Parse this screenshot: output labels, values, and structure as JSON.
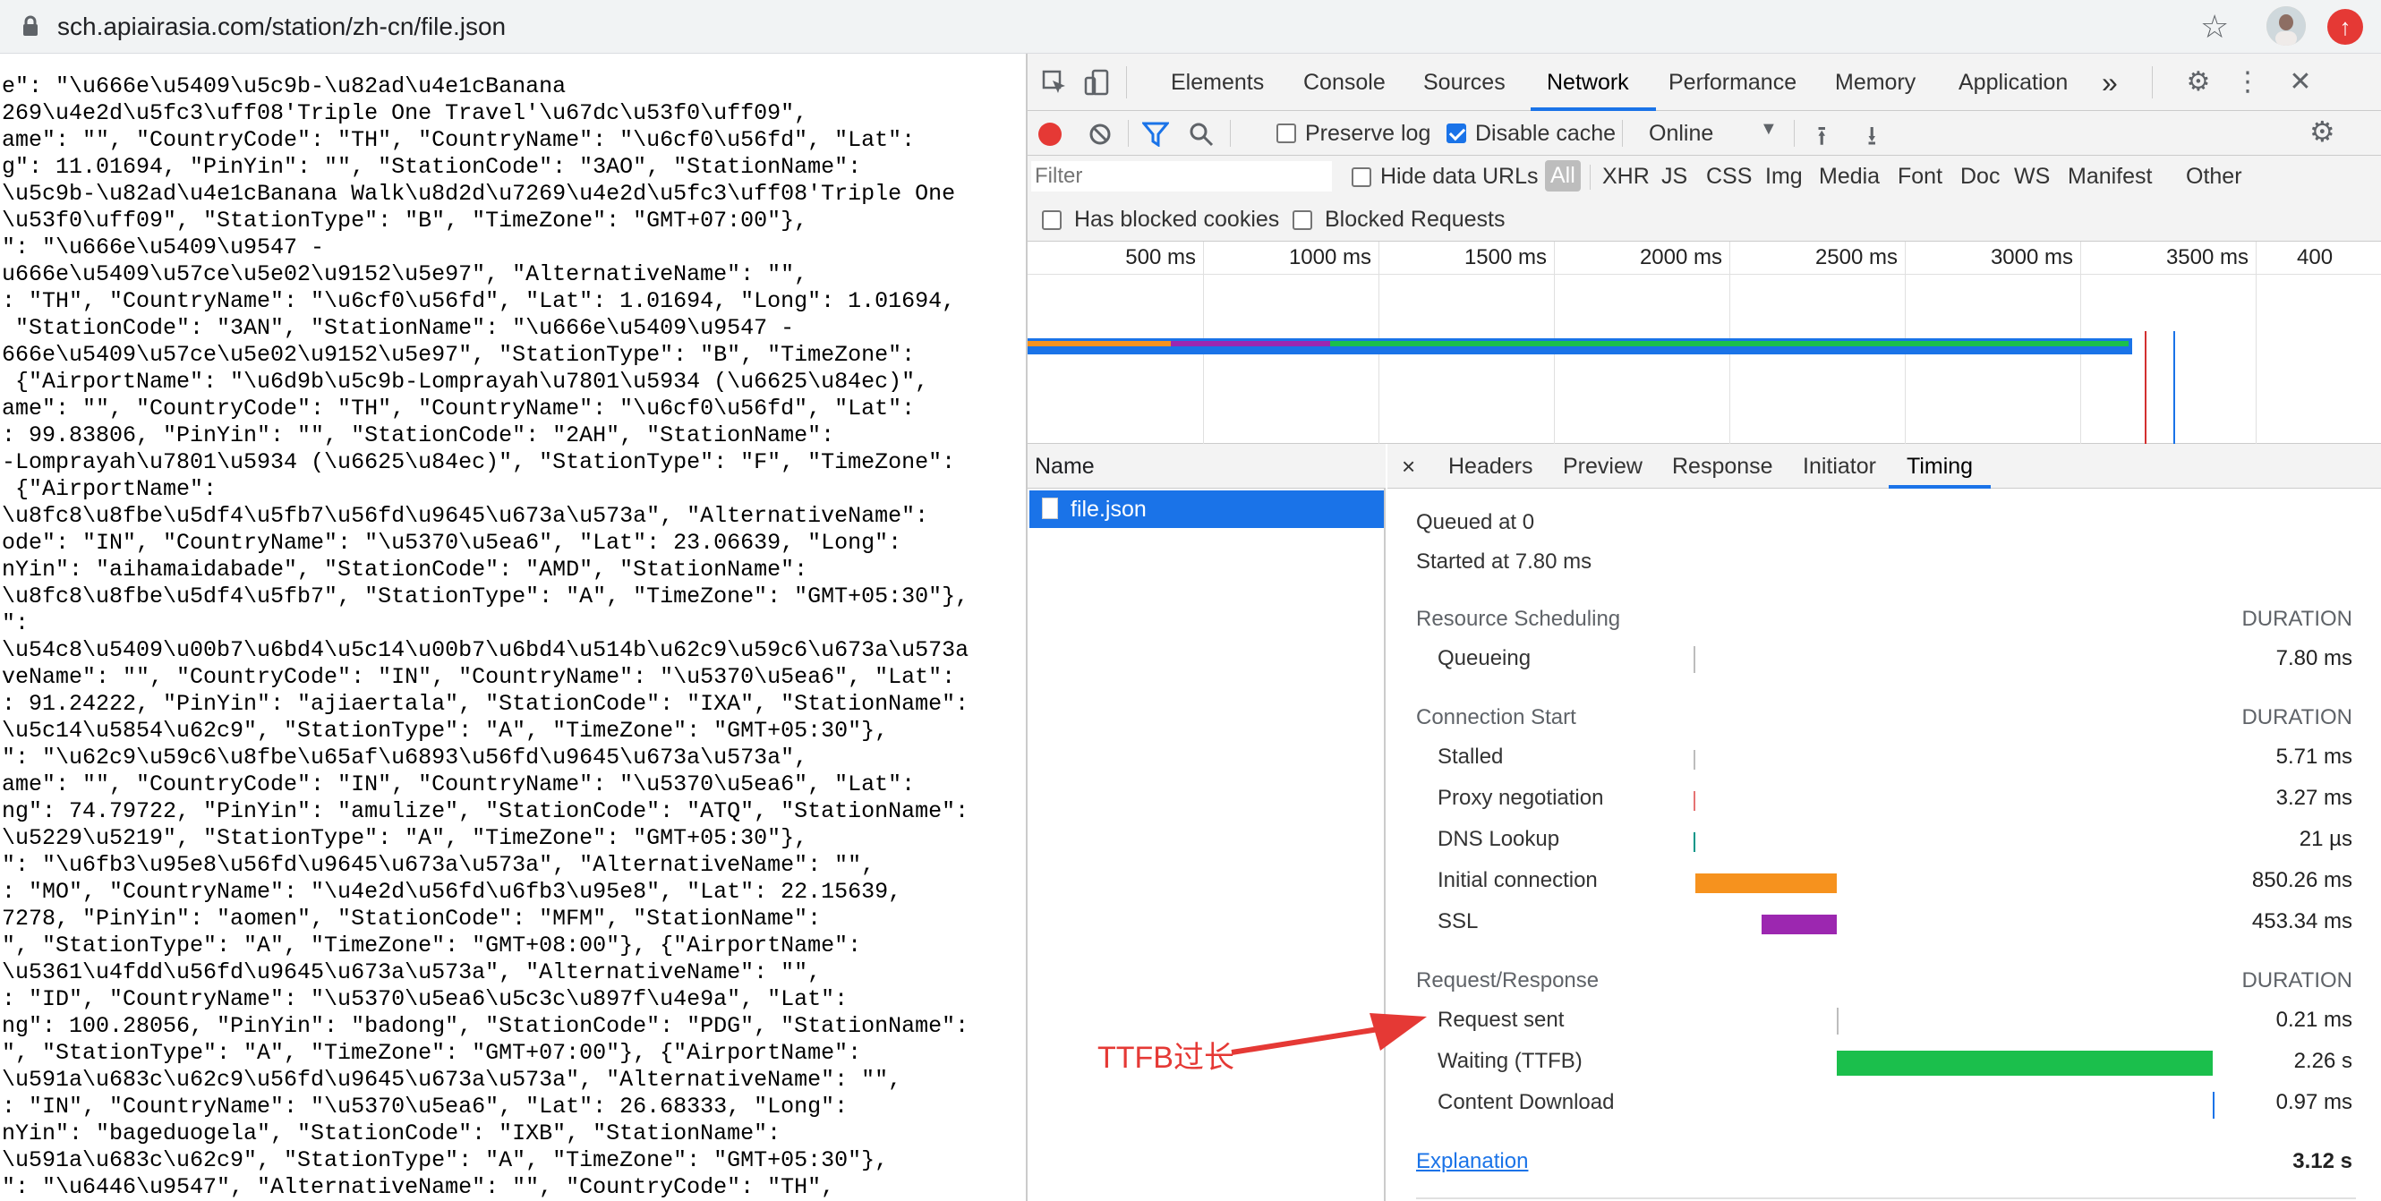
{
  "browser": {
    "url": "sch.apiairasia.com/station/zh-cn/file.json"
  },
  "json_lines": [
    "e\": \"\\u666e\\u5409\\u5c9b-\\u82ad\\u4e1cBanana",
    "269\\u4e2d\\u5fc3\\uff08'Triple One Travel'\\u67dc\\u53f0\\uff09\",",
    "ame\": \"\", \"CountryCode\": \"TH\", \"CountryName\": \"\\u6cf0\\u56fd\", \"Lat\":",
    "g\": 11.01694, \"PinYin\": \"\", \"StationCode\": \"3AO\", \"StationName\":",
    "\\u5c9b-\\u82ad\\u4e1cBanana Walk\\u8d2d\\u7269\\u4e2d\\u5fc3\\uff08'Triple One",
    "\\u53f0\\uff09\", \"StationType\": \"B\", \"TimeZone\": \"GMT+07:00\"},",
    "\": \"\\u666e\\u5409\\u9547 -",
    "u666e\\u5409\\u57ce\\u5e02\\u9152\\u5e97\", \"AlternativeName\": \"\",",
    ": \"TH\", \"CountryName\": \"\\u6cf0\\u56fd\", \"Lat\": 1.01694, \"Long\": 1.01694,",
    " \"StationCode\": \"3AN\", \"StationName\": \"\\u666e\\u5409\\u9547 -",
    "666e\\u5409\\u57ce\\u5e02\\u9152\\u5e97\", \"StationType\": \"B\", \"TimeZone\":",
    " {\"AirportName\": \"\\u6d9b\\u5c9b-Lomprayah\\u7801\\u5934 (\\u6625\\u84ec)\",",
    "ame\": \"\", \"CountryCode\": \"TH\", \"CountryName\": \"\\u6cf0\\u56fd\", \"Lat\":",
    ": 99.83806, \"PinYin\": \"\", \"StationCode\": \"2AH\", \"StationName\":",
    "-Lomprayah\\u7801\\u5934 (\\u6625\\u84ec)\", \"StationType\": \"F\", \"TimeZone\":",
    " {\"AirportName\":",
    "\\u8fc8\\u8fbe\\u5df4\\u5fb7\\u56fd\\u9645\\u673a\\u573a\", \"AlternativeName\":",
    "ode\": \"IN\", \"CountryName\": \"\\u5370\\u5ea6\", \"Lat\": 23.06639, \"Long\":",
    "nYin\": \"aihamaidabade\", \"StationCode\": \"AMD\", \"StationName\":",
    "\\u8fc8\\u8fbe\\u5df4\\u5fb7\", \"StationType\": \"A\", \"TimeZone\": \"GMT+05:30\"},",
    "\":",
    "\\u54c8\\u5409\\u00b7\\u6bd4\\u5c14\\u00b7\\u6bd4\\u514b\\u62c9\\u59c6\\u673a\\u573a",
    "veName\": \"\", \"CountryCode\": \"IN\", \"CountryName\": \"\\u5370\\u5ea6\", \"Lat\":",
    ": 91.24222, \"PinYin\": \"ajiaertala\", \"StationCode\": \"IXA\", \"StationName\":",
    "\\u5c14\\u5854\\u62c9\", \"StationType\": \"A\", \"TimeZone\": \"GMT+05:30\"},",
    "\": \"\\u62c9\\u59c6\\u8fbe\\u65af\\u6893\\u56fd\\u9645\\u673a\\u573a\",",
    "ame\": \"\", \"CountryCode\": \"IN\", \"CountryName\": \"\\u5370\\u5ea6\", \"Lat\":",
    "ng\": 74.79722, \"PinYin\": \"amulize\", \"StationCode\": \"ATQ\", \"StationName\":",
    "\\u5229\\u5219\", \"StationType\": \"A\", \"TimeZone\": \"GMT+05:30\"},",
    "\": \"\\u6fb3\\u95e8\\u56fd\\u9645\\u673a\\u573a\", \"AlternativeName\": \"\",",
    ": \"MO\", \"CountryName\": \"\\u4e2d\\u56fd\\u6fb3\\u95e8\", \"Lat\": 22.15639,",
    "7278, \"PinYin\": \"aomen\", \"StationCode\": \"MFM\", \"StationName\":",
    "\", \"StationType\": \"A\", \"TimeZone\": \"GMT+08:00\"}, {\"AirportName\":",
    "\\u5361\\u4fdd\\u56fd\\u9645\\u673a\\u573a\", \"AlternativeName\": \"\",",
    ": \"ID\", \"CountryName\": \"\\u5370\\u5ea6\\u5c3c\\u897f\\u4e9a\", \"Lat\":",
    "ng\": 100.28056, \"PinYin\": \"badong\", \"StationCode\": \"PDG\", \"StationName\":",
    "\", \"StationType\": \"A\", \"TimeZone\": \"GMT+07:00\"}, {\"AirportName\":",
    "\\u591a\\u683c\\u62c9\\u56fd\\u9645\\u673a\\u573a\", \"AlternativeName\": \"\",",
    ": \"IN\", \"CountryName\": \"\\u5370\\u5ea6\", \"Lat\": 26.68333, \"Long\":",
    "nYin\": \"bageduogela\", \"StationCode\": \"IXB\", \"StationName\":",
    "\\u591a\\u683c\\u62c9\", \"StationType\": \"A\", \"TimeZone\": \"GMT+05:30\"},",
    "\": \"\\u6446\\u9547\", \"AlternativeName\": \"\", \"CountryCode\": \"TH\","
  ],
  "devtools": {
    "tabs": [
      "Elements",
      "Console",
      "Sources",
      "Network",
      "Performance",
      "Memory",
      "Application"
    ],
    "active_tab": "Network",
    "more": "»",
    "toolbar": {
      "preserve_log": "Preserve log",
      "disable_cache": "Disable cache",
      "throttle": "Online"
    },
    "filter": {
      "placeholder": "Filter",
      "hide_data_urls": "Hide data URLs",
      "types": [
        "All",
        "XHR",
        "JS",
        "CSS",
        "Img",
        "Media",
        "Font",
        "Doc",
        "WS",
        "Manifest",
        "Other"
      ],
      "has_blocked_cookies": "Has blocked cookies",
      "blocked_requests": "Blocked Requests"
    },
    "overview_ticks": [
      "500 ms",
      "1000 ms",
      "1500 ms",
      "2000 ms",
      "2500 ms",
      "3000 ms",
      "3500 ms",
      "400"
    ],
    "name_header": "Name",
    "request": "file.json",
    "detail_tabs": [
      "×",
      "Headers",
      "Preview",
      "Response",
      "Initiator",
      "Timing"
    ],
    "timing": {
      "queued": "Queued at 0",
      "started": "Started at 7.80 ms",
      "duration_label": "DURATION",
      "sections": [
        {
          "title": "Resource Scheduling",
          "rows": [
            {
              "label": "Queueing",
              "value": "7.80 ms",
              "color": "#bdbdbd"
            }
          ]
        },
        {
          "title": "Connection Start",
          "rows": [
            {
              "label": "Stalled",
              "value": "5.71 ms",
              "color": "#bdbdbd"
            },
            {
              "label": "Proxy negotiation",
              "value": "3.27 ms",
              "color": "#e57373"
            },
            {
              "label": "DNS Lookup",
              "value": "21 µs",
              "color": "#009688"
            },
            {
              "label": "Initial connection",
              "value": "850.26 ms",
              "color": "#f6921e"
            },
            {
              "label": "SSL",
              "value": "453.34 ms",
              "color": "#9c27b0"
            }
          ]
        },
        {
          "title": "Request/Response",
          "rows": [
            {
              "label": "Request sent",
              "value": "0.21 ms",
              "color": "#bdbdbd"
            },
            {
              "label": "Waiting (TTFB)",
              "value": "2.26 s",
              "color": "#1bbf4c"
            },
            {
              "label": "Content Download",
              "value": "0.97 ms",
              "color": "#1a73e8"
            }
          ]
        }
      ],
      "explanation": "Explanation",
      "total": "3.12 s"
    }
  },
  "annotation": "TTFB过长"
}
